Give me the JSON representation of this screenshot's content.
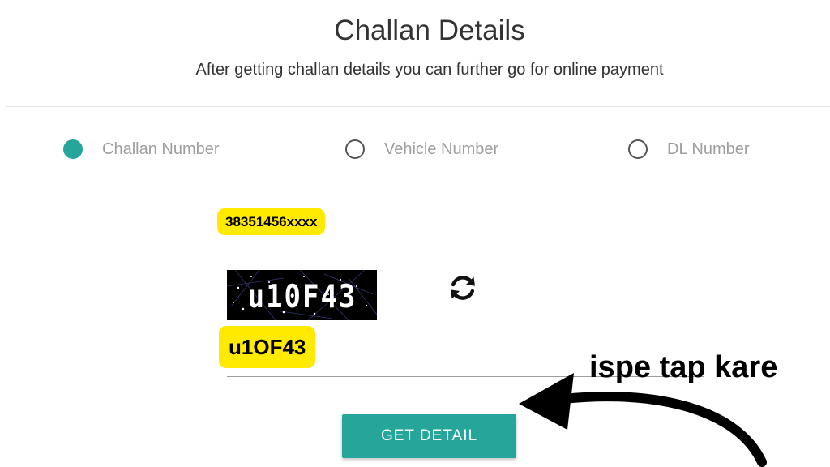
{
  "header": {
    "title": "Challan Details",
    "subtitle": "After getting challan details you can further go for online payment"
  },
  "search_options": [
    {
      "label": "Challan Number",
      "selected": true
    },
    {
      "label": "Vehicle Number",
      "selected": false
    },
    {
      "label": "DL Number",
      "selected": false
    }
  ],
  "challan_input": {
    "value": "38351456xxxx"
  },
  "captcha": {
    "image_text": "u10F43",
    "refresh_icon": "refresh-icon"
  },
  "captcha_input": {
    "value": "u1OF43"
  },
  "submit_button": {
    "label": "GET DETAIL"
  },
  "annotation": {
    "text": "ispe tap kare",
    "arrow_icon": "curved-arrow-icon"
  },
  "colors": {
    "accent": "#26a69a",
    "highlight": "#ffea00",
    "text": "#333333",
    "muted": "#9e9e9e"
  }
}
